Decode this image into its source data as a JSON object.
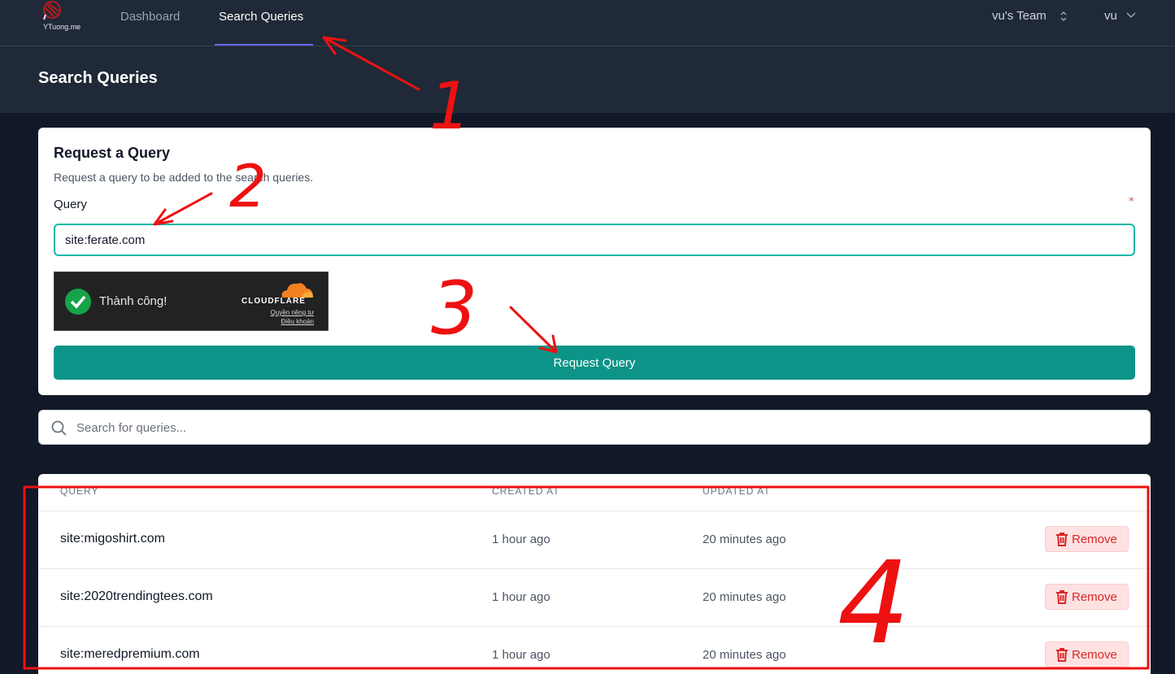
{
  "nav": {
    "logo_text": "YTuong.me",
    "links": [
      {
        "label": "Dashboard"
      },
      {
        "label": "Search Queries"
      }
    ],
    "team": "vu's Team",
    "user": "vu"
  },
  "header": {
    "title": "Search Queries"
  },
  "request_card": {
    "title": "Request a Query",
    "subtitle": "Request a query to be added to the search queries.",
    "query_label": "Query",
    "required_mark": "*",
    "query_value": "site:ferate.com",
    "captcha": {
      "status": "Thành công!",
      "brand": "CLOUDFLARE",
      "privacy": "Quyền riêng tư",
      "terms": "Điều khoản"
    },
    "submit_label": "Request Query"
  },
  "search": {
    "placeholder": "Search for queries..."
  },
  "table": {
    "headers": [
      "QUERY",
      "CREATED AT",
      "UPDATED AT"
    ],
    "rows": [
      {
        "query": "site:migoshirt.com",
        "created": "1 hour ago",
        "updated": "20 minutes ago",
        "action": "Remove"
      },
      {
        "query": "site:2020trendingtees.com",
        "created": "1 hour ago",
        "updated": "20 minutes ago",
        "action": "Remove"
      },
      {
        "query": "site:meredpremium.com",
        "created": "1 hour ago",
        "updated": "20 minutes ago",
        "action": "Remove"
      }
    ]
  },
  "annotations": {
    "labels": [
      "1",
      "2",
      "3",
      "4"
    ],
    "color": "#ee1111"
  },
  "colors": {
    "accent": "#0d9488",
    "nav_bg": "#1f2937",
    "page_bg": "#111827",
    "danger": "#dc2626"
  }
}
